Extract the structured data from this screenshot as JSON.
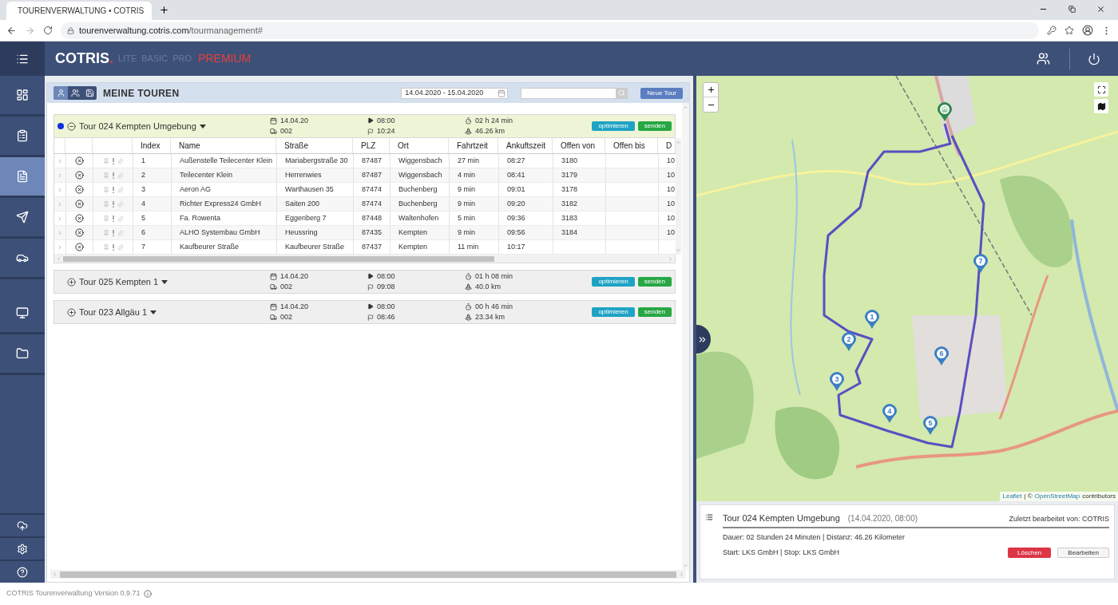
{
  "browser": {
    "tab_title": "TOURENVERWALTUNG • COTRIS",
    "url_host": "tourenverwaltung.cotris.com",
    "url_path": "/tourmanagement#"
  },
  "header": {
    "logo": "COTRIS",
    "logo_dot": ".",
    "editions": [
      {
        "label": "LITE",
        "selected": false
      },
      {
        "label": "BASIC",
        "selected": false
      },
      {
        "label": "PRO",
        "selected": false
      },
      {
        "label": "PREMIUM",
        "selected": true
      }
    ]
  },
  "sidebar": {
    "items": [
      {
        "selected": false
      },
      {
        "selected": false
      },
      {
        "selected": true
      },
      {
        "selected": false
      },
      {
        "selected": false
      },
      {
        "selected": false
      },
      {
        "selected": false
      }
    ],
    "bottom_items": [
      {
        "selected": false
      },
      {
        "selected": false
      },
      {
        "selected": false
      }
    ]
  },
  "panel": {
    "title": "MEINE TOUREN",
    "view_buttons": [
      {
        "selected": true
      },
      {
        "selected": false
      },
      {
        "selected": false
      }
    ],
    "date_range": "14.04.2020 - 15.04.2020",
    "new_tour_button": "Neue Tour"
  },
  "tours": [
    {
      "name": "Tour 024 Kempten Umgebung",
      "expanded": true,
      "color": "#1030e0",
      "date": "14.04.20",
      "vehicle": "002",
      "start": "08:00",
      "end": "10:24",
      "duration": "02 h 24 min",
      "distance": "46.26 km",
      "buttons": [
        "optimieren",
        "senden"
      ],
      "table": {
        "columns": [
          "Index",
          "Name",
          "Straße",
          "PLZ",
          "Ort",
          "Fahrtzeit",
          "Ankuftszeit",
          "Offen von",
          "Offen bis",
          "D"
        ],
        "rows": [
          [
            "1",
            "Außenstelle Teilecenter Klein",
            "Mariabergstraße 30",
            "87487",
            "Wiggensbach",
            "27 min",
            "08:27",
            "3180",
            "",
            "10"
          ],
          [
            "2",
            "Teilecenter Klein",
            "Herrenwies",
            "87487",
            "Wiggensbach",
            "4 min",
            "08:41",
            "3179",
            "",
            "10"
          ],
          [
            "3",
            "Aeron AG",
            "Warthausen 35",
            "87474",
            "Buchenberg",
            "9 min",
            "09:01",
            "3178",
            "",
            "10"
          ],
          [
            "4",
            "Richter Express24 GmbH",
            "Saiten 200",
            "87474",
            "Buchenberg",
            "9 min",
            "09:20",
            "3182",
            "",
            "10"
          ],
          [
            "5",
            "Fa. Rowenta",
            "Eggenberg 7",
            "87448",
            "Waltenhofen",
            "5 min",
            "09:36",
            "3183",
            "",
            "10"
          ],
          [
            "6",
            "ALHO Systembau GmbH",
            "Heussring",
            "87435",
            "Kempten",
            "9 min",
            "09:56",
            "3184",
            "",
            "10"
          ],
          [
            "7",
            "Kaufbeurer Straße",
            "Kaufbeurer Straße",
            "87437",
            "Kempten",
            "11 min",
            "10:17",
            "",
            "",
            ""
          ]
        ]
      }
    },
    {
      "name": "Tour 025 Kempten 1",
      "expanded": false,
      "date": "14.04.20",
      "vehicle": "002",
      "start": "08:00",
      "end": "09:08",
      "duration": "01 h 08 min",
      "distance": "40.0 km",
      "buttons": [
        "optimieren",
        "senden"
      ]
    },
    {
      "name": "Tour 023 Allgäu 1",
      "expanded": false,
      "date": "14.04.20",
      "vehicle": "002",
      "start": "08:00",
      "end": "08:46",
      "duration": "00 h 46 min",
      "distance": "23.34 km",
      "buttons": [
        "optimieren",
        "senden"
      ]
    }
  ],
  "map": {
    "markers": [
      "1",
      "2",
      "3",
      "4",
      "5",
      "6",
      "7"
    ],
    "attribution_link": "Leaflet",
    "attribution_sep": "| ©",
    "attribution_osm": "OpenStreetMap",
    "attribution_rest": "contributors"
  },
  "info": {
    "title": "Tour 024 Kempten Umgebung",
    "date": "(14.04.2020, 08:00)",
    "edited_by": "Zuletzt bearbeitet von: COTRIS",
    "summary": "Dauer: 02 Stunden 24 Minuten | Distanz: 46.26 Kilometer",
    "stops": "Start: LKS GmbH | Stop: LKS GmbH",
    "buttons": [
      "Löschen",
      "Bearbeiten"
    ]
  },
  "footer": "COTRIS Tourenverwaltung Version 0.9.71"
}
